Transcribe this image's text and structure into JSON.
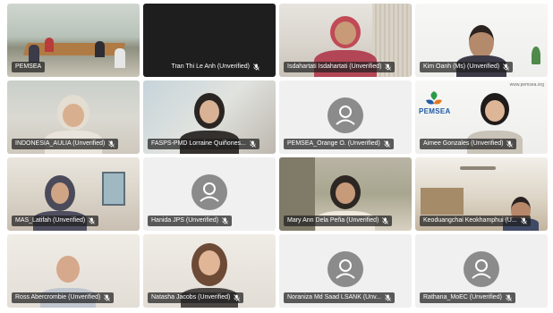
{
  "participants": [
    {
      "name": "PEMSEA",
      "video": true
    },
    {
      "name": "Tran Thi Le Anh (Unverified)",
      "video": false
    },
    {
      "name": "Isdahartati Isdahartati (Unverified)",
      "video": true
    },
    {
      "name": "Kim Oanh (Ms) (Unverified)",
      "video": true
    },
    {
      "name": "INDONESIA_AULIA (Unverified)",
      "video": true
    },
    {
      "name": "FASPS-PMD Lorraine Quiñones...",
      "video": true
    },
    {
      "name": "PEMSEA_Orange O. (Unverified)",
      "video": false
    },
    {
      "name": "Aimee Gonzales (Unverified)",
      "video": true
    },
    {
      "name": "MAS_Latifah (Unverified)",
      "video": true
    },
    {
      "name": "Hanida JPS (Unverified)",
      "video": false
    },
    {
      "name": "Mary Ann Dela Peña (Unverified)",
      "video": true
    },
    {
      "name": "Keoduangchai Keokhamphui (U...",
      "video": true
    },
    {
      "name": "Ross Abercrombie (Unverified)",
      "video": true
    },
    {
      "name": "Natasha Jacobs (Unverified)",
      "video": true
    },
    {
      "name": "Noraniza Md Saad LSANK (Unv...",
      "video": false
    },
    {
      "name": "Rathana_MoEC (Unverified)",
      "video": false
    }
  ],
  "branding": {
    "logo_text": "PEMSEA",
    "url": "www.pemsea.org"
  },
  "icons": {
    "mic": "mic-muted-icon",
    "avatar": "user-avatar-icon"
  }
}
